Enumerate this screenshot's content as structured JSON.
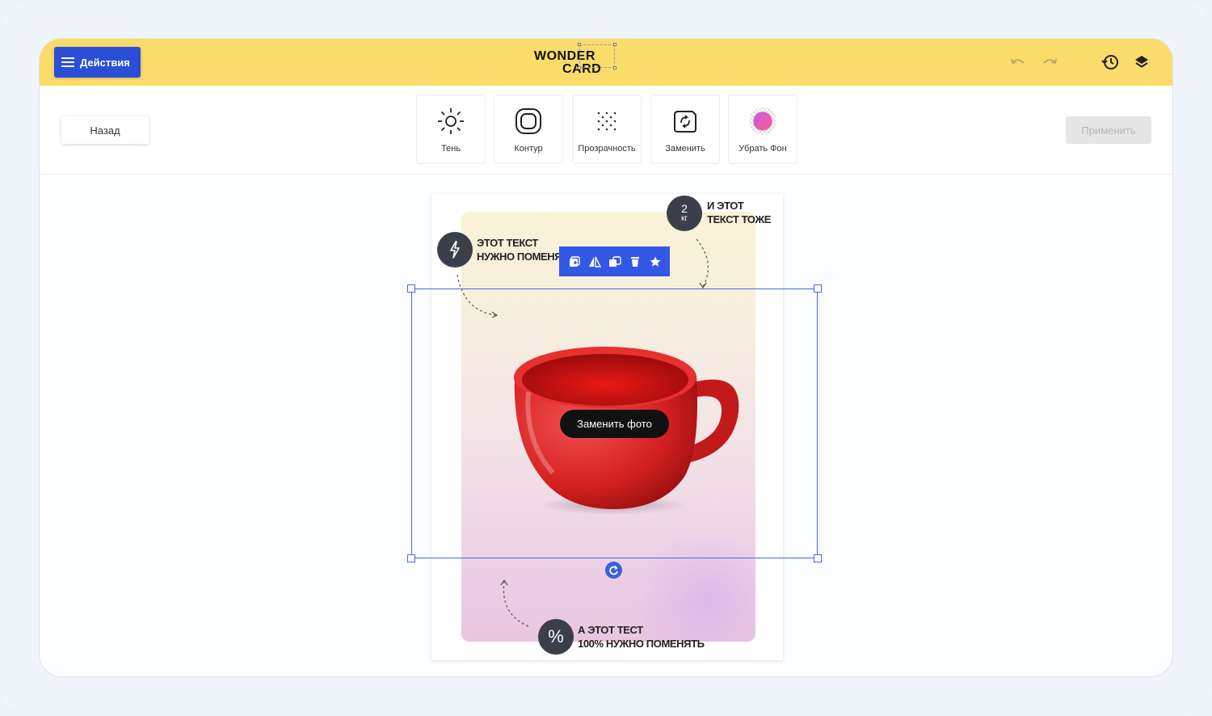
{
  "header": {
    "actions_label": "Действия",
    "logo_line1": "WONDER",
    "logo_line2": "CARD",
    "icons": [
      "undo-icon",
      "redo-icon",
      "history-icon",
      "layers-icon"
    ]
  },
  "toolbar": {
    "back_label": "Назад",
    "apply_label": "Применить",
    "tools": [
      {
        "label": "Тень",
        "icon": "sun-icon"
      },
      {
        "label": "Контур",
        "icon": "outline-icon"
      },
      {
        "label": "Прозрачность",
        "icon": "transparency-icon"
      },
      {
        "label": "Заменить",
        "icon": "replace-icon"
      },
      {
        "label": "Убрать Фон",
        "icon": "remove-bg-icon"
      }
    ]
  },
  "card": {
    "badge_top_right": {
      "value": "2",
      "unit": "кг"
    },
    "text_top_right": "И ЭТОТ\nТЕКСТ ТОЖЕ",
    "text_top_left": "ЭТОТ ТЕКСТ\nНУЖНО ПОМЕНЯТЬ",
    "badge_bottom": "%",
    "text_bottom": "А ЭТОТ ТЕСТ\n100% НУЖНО ПОМЕНЯТЬ",
    "replace_photo_label": "Заменить фото"
  },
  "mini_toolbar": {
    "icons": [
      "duplicate-icon",
      "flip-icon",
      "copy-style-icon",
      "delete-icon",
      "favorite-icon"
    ]
  },
  "colors": {
    "header_bg": "#fbdb69",
    "accent": "#2a4fd6",
    "selection": "#4d64e8"
  }
}
